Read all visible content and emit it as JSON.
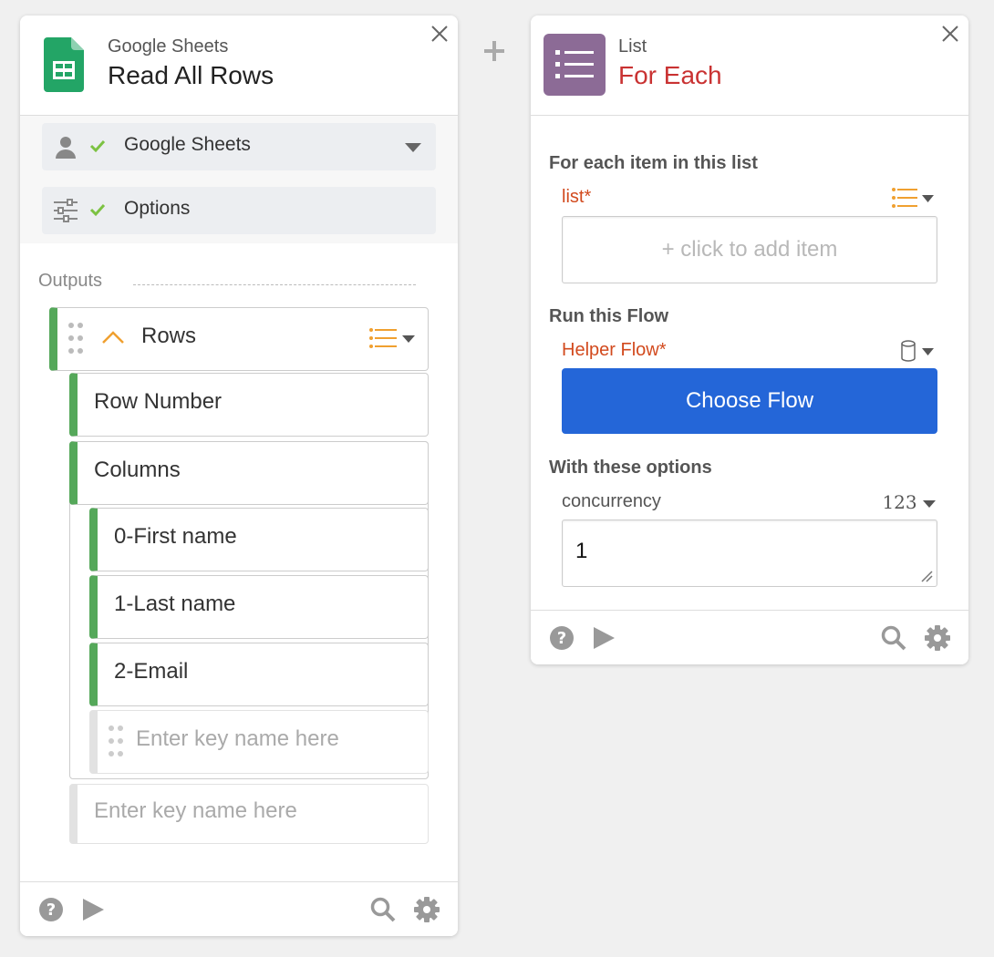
{
  "left_card": {
    "app_name": "Google Sheets",
    "action_name": "Read All Rows",
    "connection_label": "Google Sheets",
    "options_label": "Options",
    "outputs_label": "Outputs",
    "rows_label": "Rows",
    "row_number_label": "Row Number",
    "columns_label": "Columns",
    "column_items": [
      "0-First name",
      "1-Last name",
      "2-Email"
    ],
    "inner_placeholder": "Enter key name here",
    "outer_placeholder": "Enter key name here"
  },
  "right_card": {
    "app_name": "List",
    "action_name": "For Each",
    "section_list_title": "For each item in this list",
    "list_field_label": "list*",
    "add_item_text": "+ click to add item",
    "section_flow_title": "Run this Flow",
    "helper_flow_label": "Helper Flow*",
    "choose_flow_label": "Choose Flow",
    "section_options_title": "With these options",
    "concurrency_label": "concurrency",
    "concurrency_type": "123",
    "concurrency_value": "1"
  },
  "colors": {
    "accent_green": "#55a85a",
    "accent_green_light": "#a4d5a4",
    "check_green": "#7cc242",
    "list_purple": "#8c6b96",
    "for_each_red": "#c93232",
    "required_orange": "#d24a1e",
    "list_icon_orange": "#f0a030",
    "button_blue": "#2466d8"
  },
  "icons": {
    "close": "close-icon",
    "user": "user-icon",
    "check": "check-icon",
    "caret": "caret-down-icon",
    "sliders": "sliders-icon",
    "drag": "drag-handle-icon",
    "collapse": "chevron-up-icon",
    "list": "list-icon",
    "database": "database-icon",
    "help": "help-icon",
    "play": "play-icon",
    "search": "search-icon",
    "settings": "gear-icon",
    "plus": "plus-icon"
  }
}
